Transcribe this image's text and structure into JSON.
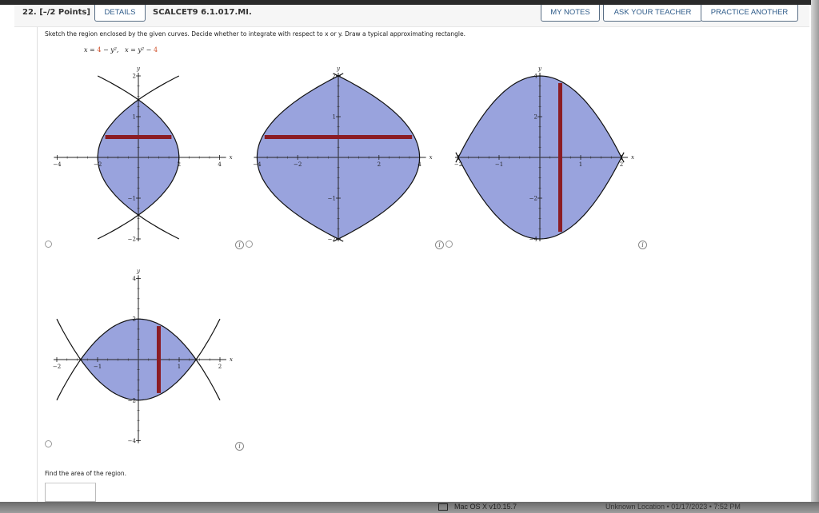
{
  "header": {
    "question_number": "22. [–/2 Points]",
    "details_label": "DETAILS",
    "problem_code": "SCALCET9 6.1.017.MI.",
    "my_notes_label": "MY NOTES",
    "ask_teacher_label": "ASK YOUR TEACHER",
    "practice_another_label": "PRACTICE ANOTHER"
  },
  "problem": {
    "prompt": "Sketch the region enclosed by the given curves. Decide whether to integrate with respect to x or y. Draw a typical approximating rectangle.",
    "eq1_prefix": "x = ",
    "eq1_const": "4",
    "eq1_suffix": " − y²,",
    "eq2_prefix": "x = y² − ",
    "eq2_const": "4",
    "find_area_label": "Find the area of the region.",
    "answer_value": ""
  },
  "colors": {
    "region_fill": "#99a3dd",
    "rectangle": "#8b1c24",
    "accent": "#2f5c8a",
    "equation_constant": "#d0532e"
  },
  "chart_data": [
    {
      "type": "area",
      "curves": [
        "x = 2 - y^2",
        "x = y^2 - 2"
      ],
      "xlim": [
        -4,
        4
      ],
      "ylim": [
        -2,
        2
      ],
      "xticks": [
        -4,
        -2,
        2,
        4
      ],
      "yticks": [
        -2,
        -1,
        1,
        2
      ],
      "xlabel": "x",
      "ylabel": "y",
      "rectangle": {
        "orientation": "horizontal",
        "at": 0.5
      },
      "selected": false
    },
    {
      "type": "area",
      "curves": [
        "x = 4 - y^2",
        "x = y^2 - 4"
      ],
      "xlim": [
        -4,
        4
      ],
      "ylim": [
        -2,
        2
      ],
      "xticks": [
        -4,
        -2,
        2,
        4
      ],
      "yticks": [
        -2,
        -1,
        1,
        2
      ],
      "xlabel": "x",
      "ylabel": "y",
      "rectangle": {
        "orientation": "horizontal",
        "at": 0.5
      },
      "selected": false
    },
    {
      "type": "area",
      "curves": [
        "y = 4 - x^2",
        "y = x^2 - 4"
      ],
      "xlim": [
        -2,
        2
      ],
      "ylim": [
        -4,
        4
      ],
      "xticks": [
        -2,
        -1,
        1,
        2
      ],
      "yticks": [
        -4,
        -2,
        2,
        4
      ],
      "xlabel": "x",
      "ylabel": "y",
      "rectangle": {
        "orientation": "vertical",
        "at": 0.5
      },
      "selected": false
    },
    {
      "type": "area",
      "curves": [
        "y = 2 - x^2",
        "y = x^2 - 2"
      ],
      "xlim": [
        -2,
        2
      ],
      "ylim": [
        -4,
        4
      ],
      "xticks": [
        -2,
        -1,
        1,
        2
      ],
      "yticks": [
        -4,
        -2,
        2,
        4
      ],
      "xlabel": "x",
      "ylabel": "y",
      "rectangle": {
        "orientation": "vertical",
        "at": 0.5
      },
      "selected": false
    }
  ],
  "status_bar": {
    "os_label": "Mac OS X v10.15.7",
    "location_label": "Unknown Location • 01/17/2023 • 7:52 PM"
  }
}
